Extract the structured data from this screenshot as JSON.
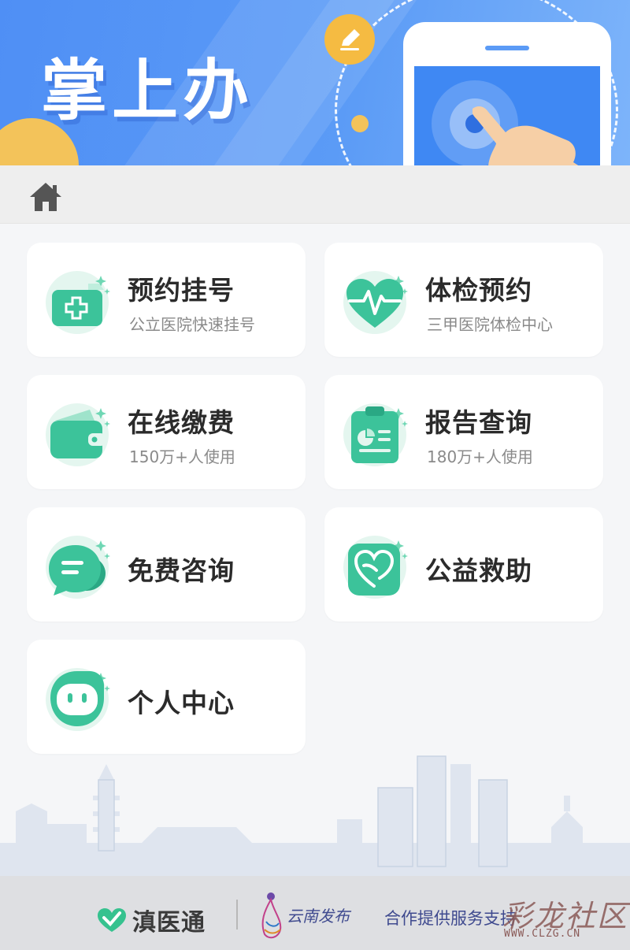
{
  "banner": {
    "title": "掌上办"
  },
  "nav": {
    "home_icon": "home-icon"
  },
  "services": [
    {
      "title": "预约挂号",
      "subtitle": "公立医院快速挂号",
      "icon": "hospital-card-icon"
    },
    {
      "title": "体检预约",
      "subtitle": "三甲医院体检中心",
      "icon": "heartbeat-icon"
    },
    {
      "title": "在线缴费",
      "subtitle": "150万+人使用",
      "icon": "wallet-icon"
    },
    {
      "title": "报告查询",
      "subtitle": "180万+人使用",
      "icon": "report-clipboard-icon"
    },
    {
      "title": "免费咨询",
      "subtitle": "",
      "icon": "chat-bubble-icon"
    },
    {
      "title": "公益救助",
      "subtitle": "",
      "icon": "heart-hand-icon"
    },
    {
      "title": "个人中心",
      "subtitle": "",
      "icon": "smiley-face-icon"
    }
  ],
  "footer": {
    "brand": "滇医通",
    "publisher": "云南发布",
    "support_text": "合作提供服务支持",
    "watermark": "彩龙社区",
    "watermark_url": "WWW.CLZG.CN"
  },
  "colors": {
    "accent_green": "#3cc39a",
    "banner_blue": "#4f8ff5",
    "yellow": "#f3c35a"
  }
}
